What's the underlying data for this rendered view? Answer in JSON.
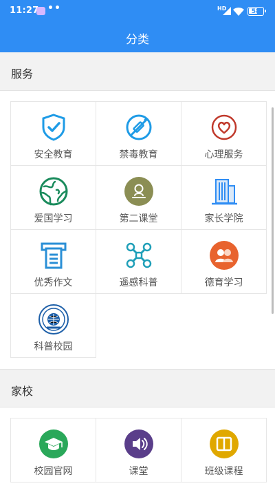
{
  "status_bar": {
    "time": "11:27",
    "dots": "••",
    "network": "HD",
    "battery": "58"
  },
  "app_bar": {
    "title": "分类"
  },
  "sections": [
    {
      "title": "服务",
      "items": [
        {
          "label": "安全教育",
          "icon": "shield-check-icon"
        },
        {
          "label": "禁毒教育",
          "icon": "no-syringe-icon"
        },
        {
          "label": "心理服务",
          "icon": "heart-circle-icon"
        },
        {
          "label": "爱国学习",
          "icon": "globe-icon"
        },
        {
          "label": "第二课堂",
          "icon": "classroom-badge-icon"
        },
        {
          "label": "家长学院",
          "icon": "building-icon"
        },
        {
          "label": "优秀作文",
          "icon": "document-printer-icon"
        },
        {
          "label": "遥感科普",
          "icon": "drone-icon"
        },
        {
          "label": "德育学习",
          "icon": "people-badge-icon"
        },
        {
          "label": "科普校园",
          "icon": "school-emblem-icon"
        }
      ]
    },
    {
      "title": "家校",
      "items": [
        {
          "label": "校园官网",
          "icon": "graduation-cap-icon"
        },
        {
          "label": "课堂",
          "icon": "speaker-icon"
        },
        {
          "label": "班级课程",
          "icon": "book-icon"
        }
      ]
    }
  ],
  "colors": {
    "primary": "#2f8df4",
    "shield": "#1e9be6",
    "syringe": "#1e9be6",
    "heart": "#c0392b",
    "globe": "#1a8b5c",
    "classroom": "#8b8e54",
    "building": "#2f8df4",
    "document": "#2a8fd6",
    "drone": "#1f9fb8",
    "people": "#e8632e",
    "emblem": "#1d5fa8",
    "cap": "#2aa85a",
    "speaker": "#5a3e8a",
    "book": "#e0a800"
  }
}
